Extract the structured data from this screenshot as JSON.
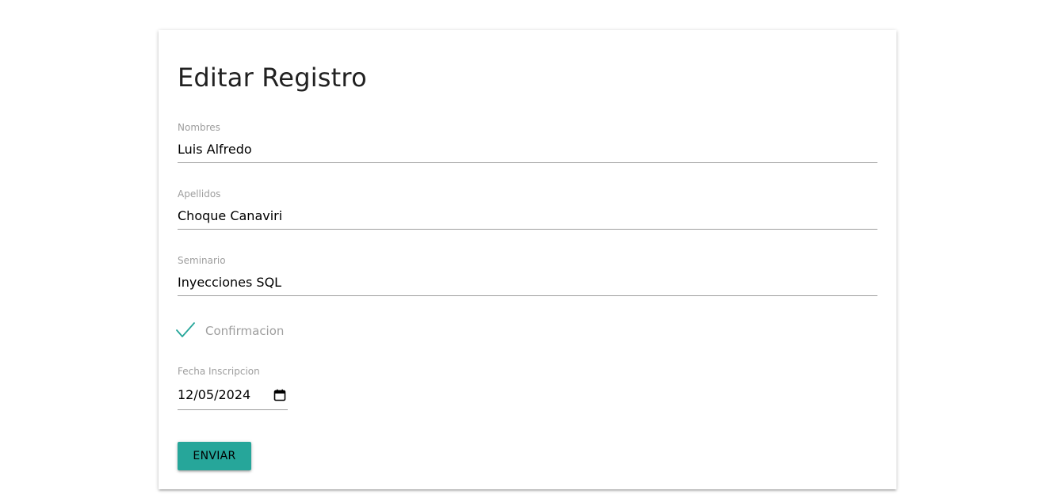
{
  "form": {
    "title": "Editar Registro",
    "fields": [
      {
        "label": "Nombres",
        "value": "Luis Alfredo"
      },
      {
        "label": "Apellidos",
        "value": "Choque Canaviri"
      },
      {
        "label": "Seminario",
        "value": "Inyecciones SQL"
      }
    ],
    "confirmation": {
      "label": "Confirmacion",
      "checked": true
    },
    "date": {
      "label": "Fecha Inscripcion",
      "value": "12/05/2024"
    },
    "submit_label": "ENVIAR"
  },
  "colors": {
    "accent": "#26a69a",
    "label": "#9e9e9e",
    "underline": "#9e9e9e"
  },
  "icons": {
    "checkbox": "checkmark-icon",
    "date": "calendar-icon"
  }
}
